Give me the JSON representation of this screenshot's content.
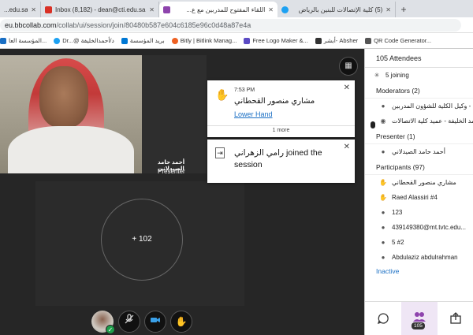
{
  "browser": {
    "tabs": [
      {
        "label": "...edu.sa",
        "favicon_color": "#6b6b6b"
      },
      {
        "label": "Inbox (8,182) - dean@cti.edu.sa",
        "favicon_color": "#d93025"
      },
      {
        "label": "اللقاء المفتوح للمدربين مع ع...",
        "favicon_color": "#8e44ad",
        "active": true
      },
      {
        "label": "(5) كلية الإتصالات للبنين بالرياض",
        "favicon_color": "#1da1f2"
      }
    ],
    "new_tab": "+",
    "url_host": "eu.bbcollab.com",
    "url_path": "/collab/ui/session/join/80480b587e604c6185e96c0d48a87e4a",
    "bookmarks": [
      {
        "label": "المؤسسة العا...",
        "color": "#1a6fc4"
      },
      {
        "label": "Dr...@ د/أحمدالخليفة",
        "color": "#1da1f2"
      },
      {
        "label": "بريد المؤسسة",
        "color": "#0078d4"
      },
      {
        "label": "Bitly | Bitlink Manag...",
        "color": "#ee6123"
      },
      {
        "label": "Free Logo Maker &...",
        "color": "#5b4bc4"
      },
      {
        "label": "أبشر- Absher",
        "color": "#333333"
      },
      {
        "label": "QR Code Generator...",
        "color": "#555555"
      }
    ]
  },
  "stage": {
    "presenter_name": "أحمد حامد الصيدلاني",
    "presenter_role": "Presenter",
    "notification_1": {
      "time": "7:53 PM",
      "name": "مشاري منصور القحطاني",
      "action": "Lower Hand",
      "more": "1 more"
    },
    "notification_2": {
      "message": "رامي الزهراني joined the session"
    },
    "overflow_count": "+ 102"
  },
  "sidebar": {
    "header": "105 Attendees",
    "joining": "5 joining",
    "moderators_header": "Moderators (2)",
    "moderators": [
      "وكيل الكلية للشؤون المدربين - ...",
      "أحمد الخليفة - عميد كلية الاتصالات"
    ],
    "presenter_header": "Presenter (1)",
    "presenters": [
      "أحمد حامد الصيدلاني"
    ],
    "participants_header": "Participants (97)",
    "participants": [
      {
        "name": "مشاري منصور القحطاني",
        "icon": "hand-icon"
      },
      {
        "name": "Raed Alassiri #4",
        "icon": "hand-icon"
      },
      {
        "name": "123",
        "icon": "user-icon"
      },
      {
        "name": "439149380@mt.tvtc.edu...",
        "icon": "user-icon"
      },
      {
        "name": "5 #2",
        "icon": "user-icon"
      },
      {
        "name": "Abdulaziz abdulrahman",
        "icon": "user-icon"
      }
    ],
    "inactive": "Inactive",
    "footer_count": "105"
  }
}
